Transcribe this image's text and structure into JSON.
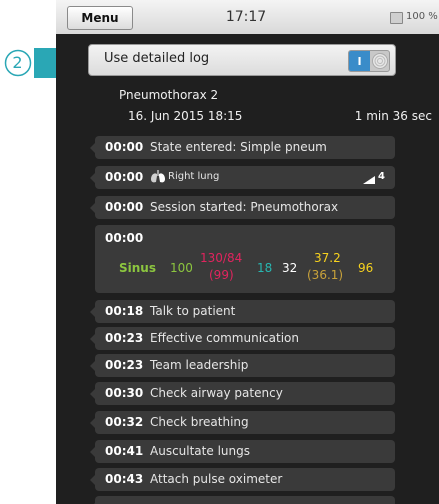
{
  "status_bar": {
    "menu_label": "Menu",
    "time": "17:17",
    "battery": "100 %"
  },
  "settings": {
    "detailed_log_label": "Use detailed log",
    "detailed_log_enabled": true,
    "toggle_on_text": "I"
  },
  "callout": {
    "number": "2"
  },
  "session": {
    "scenario": "Pneumothorax 2",
    "date": "16. Jun 2015 18:15",
    "duration": "1 min 36 sec"
  },
  "top_entries": [
    {
      "time": "00:00",
      "text": "State entered: Simple pneum"
    },
    {
      "time": "00:00",
      "text": "Right lung",
      "icon": "lungs-icon",
      "badge": "4",
      "badge_icon": "signal-icon"
    },
    {
      "time": "00:00",
      "text": "Session started: Pneumothorax"
    }
  ],
  "vitals": {
    "time": "00:00",
    "rhythm": "Sinus",
    "hr": "100",
    "bp": "130/84",
    "bp_mean": "(99)",
    "spo2": "18",
    "resp": "32",
    "temp": "37.2",
    "temp2": "(36.1)",
    "etco2": "96",
    "colors": {
      "rhythm": "#8cc63f",
      "hr": "#8cc63f",
      "bp": "#e0245e",
      "spo2": "#28b6b0",
      "resp": "#ffffff",
      "temp": "#f7d21e",
      "temp2": "#c8a23a",
      "etco2": "#f7d21e"
    }
  },
  "entries": [
    {
      "time": "00:18",
      "text": "Talk to patient"
    },
    {
      "time": "00:23",
      "text": "Effective communication"
    },
    {
      "time": "00:23",
      "text": "Team leadership"
    },
    {
      "time": "00:30",
      "text": "Check airway patency"
    },
    {
      "time": "00:32",
      "text": "Check breathing"
    },
    {
      "time": "00:41",
      "text": "Auscultate lungs"
    },
    {
      "time": "00:43",
      "text": "Attach pulse oximeter"
    },
    {
      "time": "",
      "text": ""
    }
  ]
}
